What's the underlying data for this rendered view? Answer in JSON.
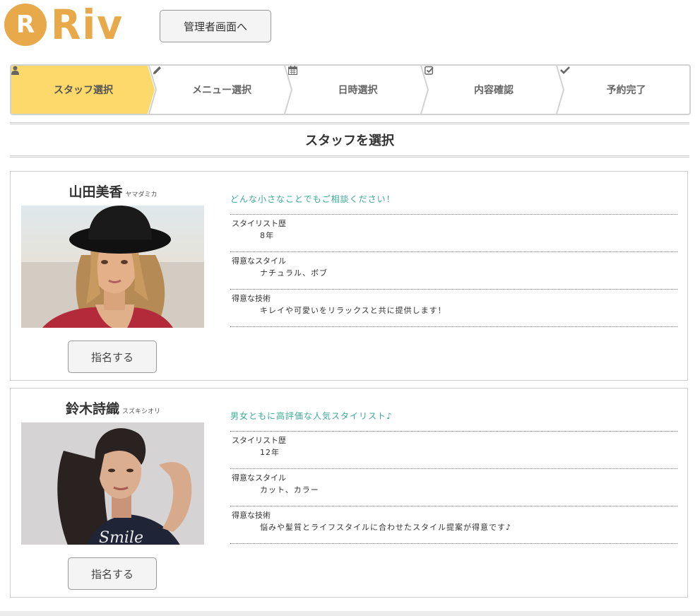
{
  "brand": {
    "logo_letter": "R",
    "logo_text": "Riv",
    "color": "#e8a94a"
  },
  "header": {
    "admin_label": "管理者画面へ"
  },
  "steps": [
    {
      "label": "スタッフ選択",
      "icon": "user-icon",
      "active": true
    },
    {
      "label": "メニュー選択",
      "icon": "pencil-icon",
      "active": false
    },
    {
      "label": "日時選択",
      "icon": "calendar-icon",
      "active": false
    },
    {
      "label": "内容確認",
      "icon": "check-square-icon",
      "active": false
    },
    {
      "label": "予約完了",
      "icon": "check-icon",
      "active": false
    }
  ],
  "colors": {
    "active_step": "#fcd96a",
    "accent_text": "#3aaa95"
  },
  "section_title": "スタッフを選択",
  "staff": [
    {
      "name": "山田美香",
      "kana": "ヤマダミカ",
      "catch": "どんな小さなことでもご相談ください！",
      "rows": [
        {
          "label": "スタイリスト歴",
          "value": "8年"
        },
        {
          "label": "得意なスタイル",
          "value": "ナチュラル、ボブ"
        },
        {
          "label": "得意な技術",
          "value": "キレイや可愛いをリラックスと共に提供します！"
        }
      ],
      "button": "指名する"
    },
    {
      "name": "鈴木詩織",
      "kana": "スズキシオリ",
      "catch": "男女ともに高評価な人気スタイリスト♪",
      "rows": [
        {
          "label": "スタイリスト歴",
          "value": "12年"
        },
        {
          "label": "得意なスタイル",
          "value": "カット、カラー"
        },
        {
          "label": "得意な技術",
          "value": "悩みや髪質とライフスタイルに合わせたスタイル提案が得意です♪"
        }
      ],
      "button": "指名する",
      "shirt_text": "Smile"
    }
  ]
}
